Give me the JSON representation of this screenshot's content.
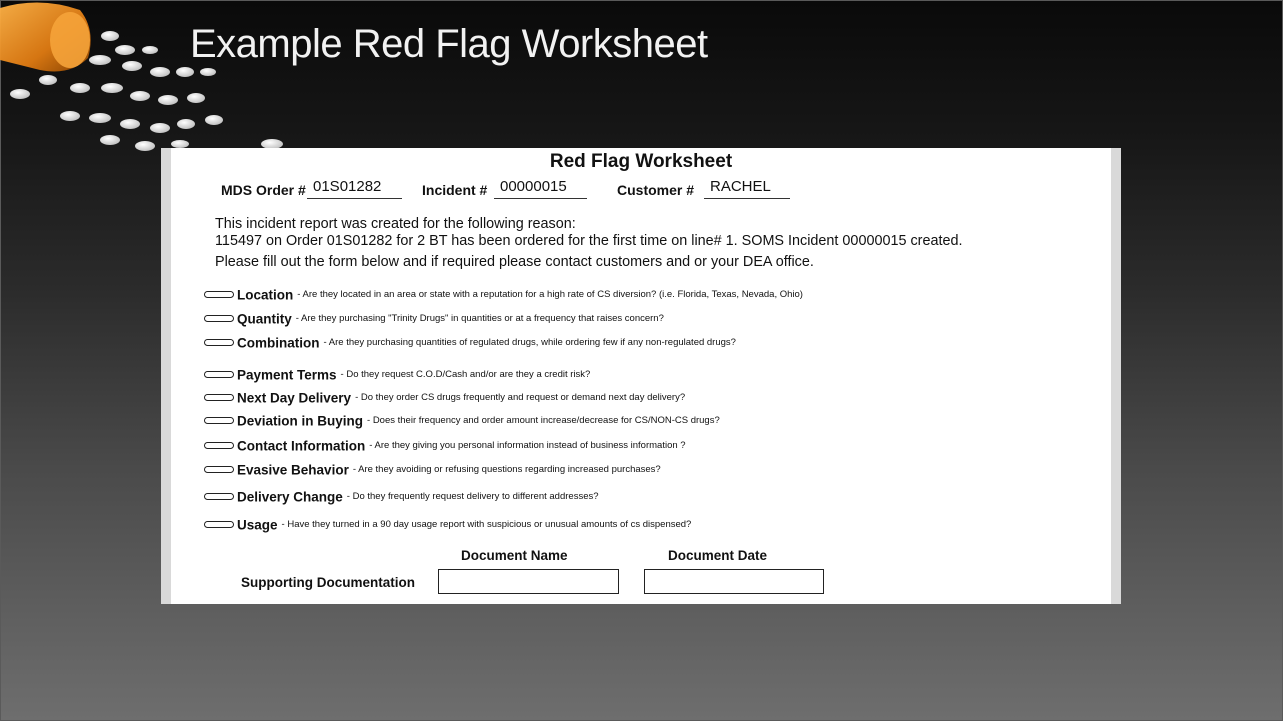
{
  "slide": {
    "title": "Example Red Flag Worksheet"
  },
  "worksheet": {
    "title": "Red Flag Worksheet",
    "header": {
      "mds_order_label": "MDS Order #",
      "mds_order_value": "01S01282",
      "incident_label": "Incident #",
      "incident_value": "00000015",
      "customer_label": "Customer #",
      "customer_value": "RACHEL"
    },
    "reason_line1": "This incident report was created for the following reason:",
    "reason_line2": "115497 on Order 01S01282 for 2 BT has been ordered for the first time on line# 1. SOMS Incident 00000015 created.",
    "instruction": "Please fill out the form below and if required please contact customers and or your DEA office.",
    "flags": [
      {
        "name": "Location",
        "desc": "- Are they located in an area or state with a reputation for a high rate of CS diversion? (i.e. Florida, Texas, Nevada, Ohio)"
      },
      {
        "name": "Quantity",
        "desc": "- Are they purchasing \"Trinity Drugs\" in quantities or at a frequency that raises concern?"
      },
      {
        "name": "Combination",
        "desc": "- Are they purchasing quantities of regulated drugs, while ordering few if any non-regulated drugs?"
      },
      {
        "name": "Payment Terms",
        "desc": "- Do they request C.O.D/Cash and/or are they a credit risk?"
      },
      {
        "name": "Next Day Delivery",
        "desc": "- Do they order CS drugs  frequently and request or demand next day delivery?"
      },
      {
        "name": "Deviation in Buying",
        "desc": "- Does their frequency and order amount increase/decrease for CS/NON-CS drugs?"
      },
      {
        "name": "Contact Information",
        "desc": "- Are they giving you personal information instead of business information ?"
      },
      {
        "name": "Evasive Behavior",
        "desc": "- Are they avoiding or refusing questions regarding increased purchases?"
      },
      {
        "name": "Delivery Change",
        "desc": "- Do they frequently request delivery to different addresses?"
      },
      {
        "name": "Usage",
        "desc": "- Have they turned in a 90 day usage report with suspicious or unusual amounts of cs dispensed?"
      }
    ],
    "documents": {
      "name_header": "Document Name",
      "date_header": "Document Date",
      "supporting_label": "Supporting Documentation",
      "name_value": "",
      "date_value": ""
    }
  }
}
